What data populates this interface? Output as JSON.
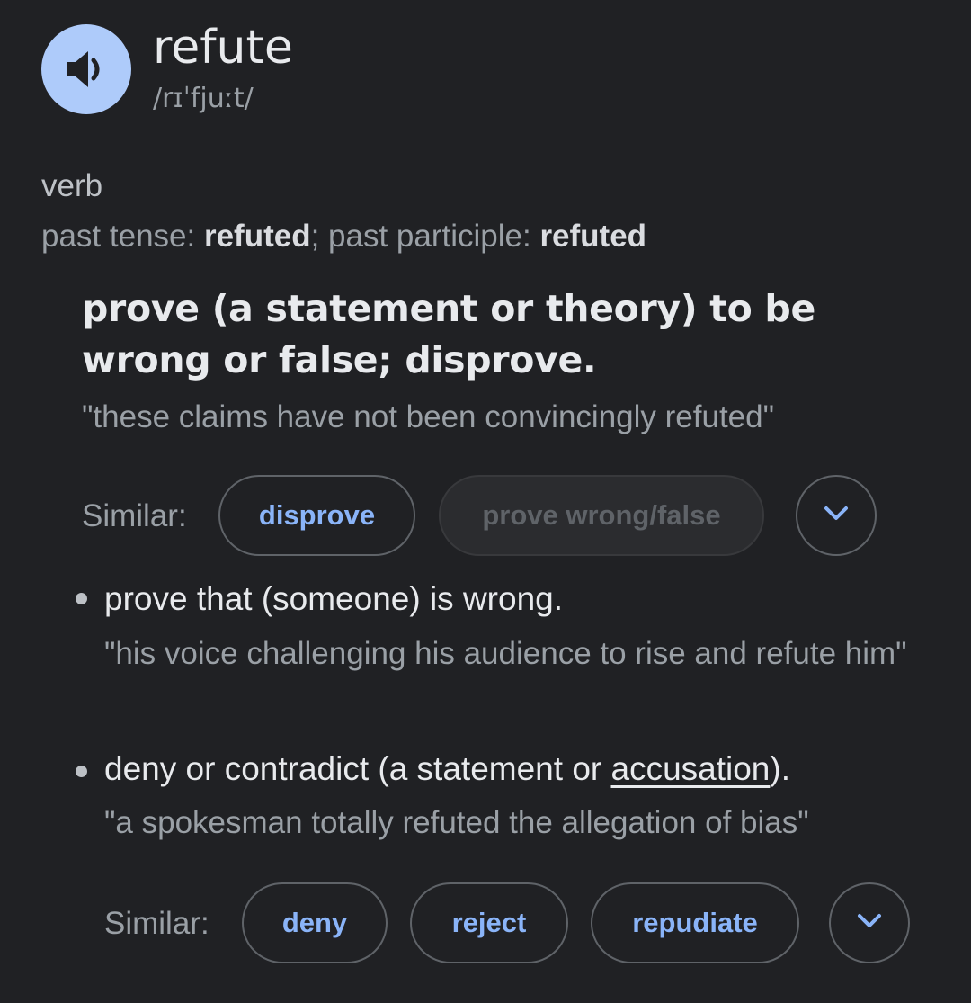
{
  "entry": {
    "word": "refute",
    "phonetic": "/rɪˈfjuːt/",
    "speaker_icon": "volume-icon"
  },
  "part_of_speech": "verb",
  "forms": {
    "past_tense_label": "past tense: ",
    "past_tense": "refuted",
    "separator": "; ",
    "past_participle_label": "past participle: ",
    "past_participle": "refuted"
  },
  "sense1": {
    "definition": "prove (a statement or theory) to be wrong or false; disprove.",
    "example": "\"these claims have not been convincingly refuted\"",
    "similar_label": "Similar:",
    "similar": [
      "disprove",
      "prove wrong/false"
    ],
    "expand_icon": "chevron-down-icon"
  },
  "subsense1": {
    "definition": "prove that (someone) is wrong.",
    "example": "\"his voice challenging his audience to rise and refute him\""
  },
  "subsense2": {
    "definition_before": "deny or contradict (a statement or ",
    "link": "accusation",
    "definition_after": ").",
    "example": "\"a spokesman totally refuted the allegation of bias\"",
    "similar_label": "Similar:",
    "similar": [
      "deny",
      "reject",
      "repudiate"
    ],
    "expand_icon": "chevron-down-icon"
  },
  "colors": {
    "background": "#202124",
    "accent": "#8ab4f8",
    "speaker_bg": "#aecbfa"
  }
}
